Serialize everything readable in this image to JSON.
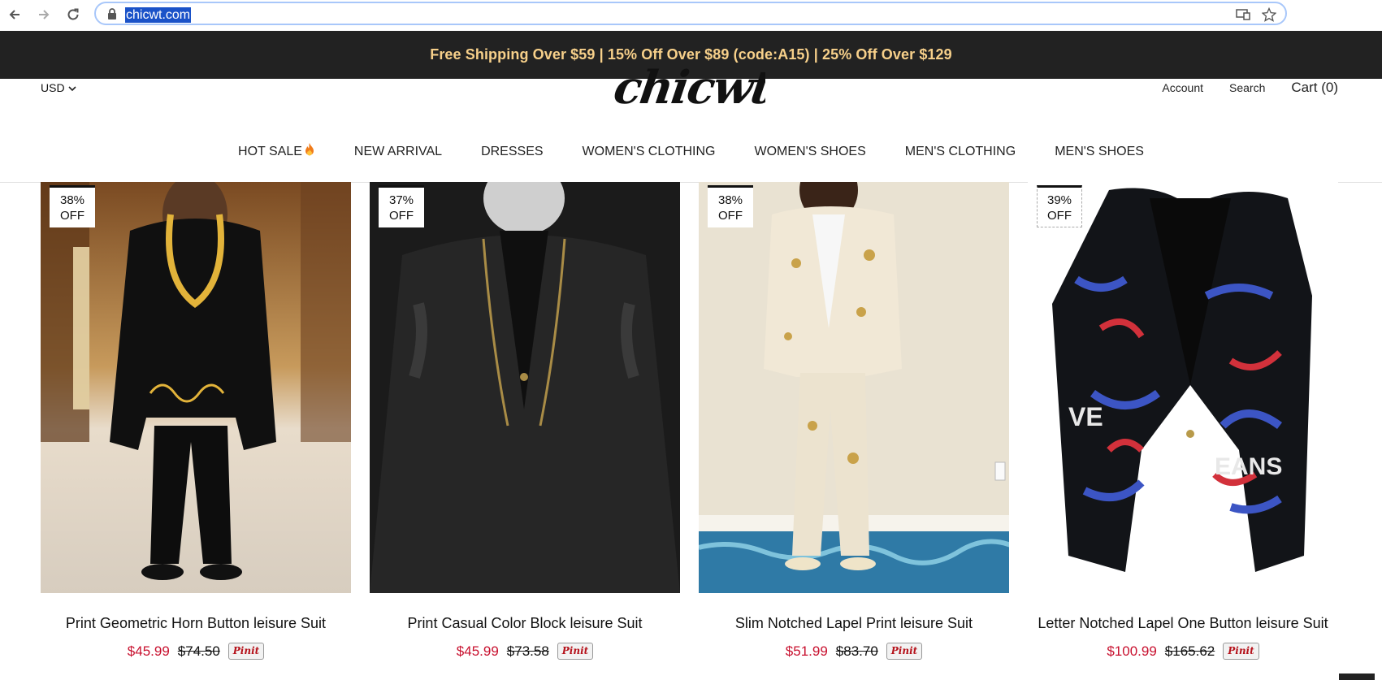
{
  "browser": {
    "url": "chicwt.com"
  },
  "promo": {
    "text": "Free Shipping Over $59 | 15% Off Over $89 (code:A15) | 25% Off Over $129"
  },
  "header": {
    "currency": "USD",
    "logo": "chicwt",
    "account": "Account",
    "search": "Search",
    "cart": "Cart (0)"
  },
  "nav": [
    {
      "label": "HOT SALE"
    },
    {
      "label": "NEW ARRIVAL"
    },
    {
      "label": "DRESSES"
    },
    {
      "label": "WOMEN'S CLOTHING"
    },
    {
      "label": "WOMEN'S SHOES"
    },
    {
      "label": "MEN'S CLOTHING"
    },
    {
      "label": "MEN'S SHOES"
    }
  ],
  "products": [
    {
      "discount_pct": "38%",
      "discount_off": "OFF",
      "title": "Print Geometric Horn Button leisure Suit",
      "price": "$45.99",
      "original": "$74.50",
      "pin": "Pinit"
    },
    {
      "discount_pct": "37%",
      "discount_off": "OFF",
      "title": "Print Casual Color Block leisure Suit",
      "price": "$45.99",
      "original": "$73.58",
      "pin": "Pinit"
    },
    {
      "discount_pct": "38%",
      "discount_off": "OFF",
      "title": "Slim Notched Lapel Print leisure Suit",
      "price": "$51.99",
      "original": "$83.70",
      "pin": "Pinit"
    },
    {
      "discount_pct": "39%",
      "discount_off": "OFF",
      "title": "Letter Notched Lapel One Button leisure Suit",
      "price": "$100.99",
      "original": "$165.62",
      "pin": "Pinit"
    }
  ]
}
